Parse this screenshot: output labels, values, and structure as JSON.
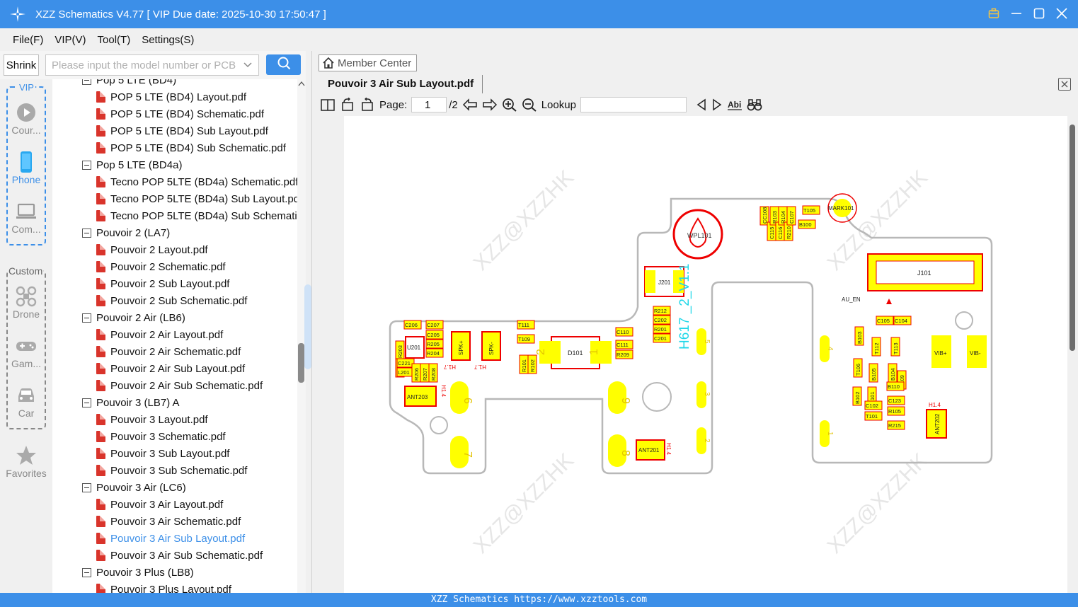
{
  "app": {
    "title": "XZZ Schematics V4.77 [ VIP Due date: 2025-10-30 17:50:47 ]"
  },
  "menu": [
    "File(F)",
    "VIP(V)",
    "Tool(T)",
    "Settings(S)"
  ],
  "search": {
    "shrink_label": "Shrink",
    "placeholder": "Please input the model number or PCB"
  },
  "sidebar": {
    "vip_label": "VIP",
    "custom_label": "Custom",
    "items": [
      {
        "label": "Cour...",
        "icon": "play-icon"
      },
      {
        "label": "Phone",
        "icon": "phone-icon"
      },
      {
        "label": "Com...",
        "icon": "laptop-icon"
      },
      {
        "label": "Drone",
        "icon": "drone-icon"
      },
      {
        "label": "Gam...",
        "icon": "gamepad-icon"
      },
      {
        "label": "Car",
        "icon": "car-icon"
      },
      {
        "label": "Favorites",
        "icon": "star-icon"
      }
    ]
  },
  "tree": [
    {
      "type": "folder",
      "label": "Pop 5 LTE (BD4)"
    },
    {
      "type": "file",
      "label": "POP 5 LTE (BD4) Layout.pdf"
    },
    {
      "type": "file",
      "label": "POP 5 LTE (BD4) Schematic.pdf"
    },
    {
      "type": "file",
      "label": "POP 5 LTE (BD4) Sub Layout.pdf"
    },
    {
      "type": "file",
      "label": "POP 5 LTE (BD4) Sub Schematic.pdf"
    },
    {
      "type": "folder",
      "label": "Pop 5 LTE (BD4a)"
    },
    {
      "type": "file",
      "label": "Tecno POP 5LTE (BD4a) Schematic.pdf"
    },
    {
      "type": "file",
      "label": "Tecno POP 5LTE (BD4a) Sub Layout.pdf"
    },
    {
      "type": "file",
      "label": "Tecno POP 5LTE (BD4a) Sub Schematic"
    },
    {
      "type": "folder",
      "label": "Pouvoir 2 (LA7)"
    },
    {
      "type": "file",
      "label": "Pouvoir 2 Layout.pdf"
    },
    {
      "type": "file",
      "label": "Pouvoir 2 Schematic.pdf"
    },
    {
      "type": "file",
      "label": "Pouvoir 2 Sub Layout.pdf"
    },
    {
      "type": "file",
      "label": "Pouvoir 2 Sub Schematic.pdf"
    },
    {
      "type": "folder",
      "label": "Pouvoir 2 Air (LB6)"
    },
    {
      "type": "file",
      "label": "Pouvoir 2 Air Layout.pdf"
    },
    {
      "type": "file",
      "label": "Pouvoir 2 Air Schematic.pdf"
    },
    {
      "type": "file",
      "label": "Pouvoir 2 Air Sub Layout.pdf"
    },
    {
      "type": "file",
      "label": "Pouvoir 2 Air Sub Schematic.pdf"
    },
    {
      "type": "folder",
      "label": "Pouvoir 3 (LB7) A"
    },
    {
      "type": "file",
      "label": "Pouvoir 3 Layout.pdf"
    },
    {
      "type": "file",
      "label": "Pouvoir 3 Schematic.pdf"
    },
    {
      "type": "file",
      "label": "Pouvoir 3 Sub Layout.pdf"
    },
    {
      "type": "file",
      "label": "Pouvoir 3 Sub Schematic.pdf"
    },
    {
      "type": "folder",
      "label": "Pouvoir 3 Air (LC6)"
    },
    {
      "type": "file",
      "label": "Pouvoir 3 Air Layout.pdf"
    },
    {
      "type": "file",
      "label": "Pouvoir 3 Air Schematic.pdf"
    },
    {
      "type": "file",
      "label": "Pouvoir 3 Air Sub Layout.pdf",
      "selected": true
    },
    {
      "type": "file",
      "label": "Pouvoir 3 Air Sub Schematic.pdf"
    },
    {
      "type": "folder",
      "label": "Pouvoir 3 Plus (LB8)"
    },
    {
      "type": "file",
      "label": "Pouvoir 3 Plus Layout.pdf"
    }
  ],
  "viewer": {
    "member_center": "Member Center",
    "doc_tab": "Pouvoir 3 Air Sub Layout.pdf",
    "page_label": "Page:",
    "page_current": "1",
    "page_total": "/2",
    "lookup_label": "Lookup"
  },
  "board": {
    "watermark": "XZZ@XZZHK",
    "labels": {
      "wpl": "WPL101",
      "mark": "MARK101",
      "j201": "J201",
      "j101": "J101",
      "version": "H617 _2_V1.1",
      "d101": "D101",
      "u201": "U201",
      "ant203": "ANT203",
      "ant201": "ANT201",
      "ant202": "ANT202",
      "spkp": "SPK+",
      "spkm": "SPK-",
      "vibp": "VIB+",
      "vibm": "VIB-",
      "au_en": "AU_EN",
      "h14": "H1.4",
      "h17": "H1.7"
    },
    "refs": [
      "C206",
      "C207",
      "C205",
      "R203",
      "R205",
      "C204",
      "R204",
      "C221",
      "L201",
      "R206",
      "R207",
      "R208",
      "T111",
      "T109",
      "R101",
      "R102",
      "C110",
      "C111",
      "R209",
      "R212",
      "C202",
      "R201",
      "C201",
      "T105",
      "B100",
      "CC108",
      "C115",
      "R103",
      "C116",
      "R104",
      "R210",
      "C107",
      "B103",
      "C105",
      "C104",
      "T112",
      "T113",
      "T106",
      "B105",
      "B104",
      "C109",
      "B110",
      "B102",
      "B101",
      "C123",
      "R105",
      "R215",
      "C102",
      "T101"
    ],
    "pad_numbers": [
      "2",
      "1",
      "6",
      "7",
      "9",
      "8",
      "5",
      "3",
      "2",
      "4",
      "1"
    ]
  },
  "status": "XZZ Schematics https://www.xzztools.com"
}
